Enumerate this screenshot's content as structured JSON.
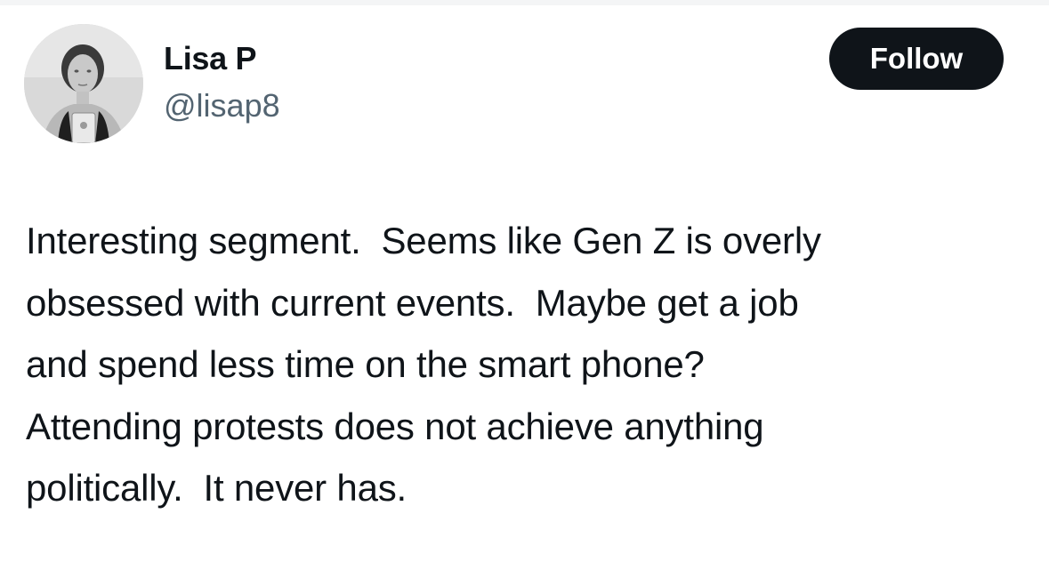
{
  "tweet": {
    "author": {
      "display_name": "Lisa P",
      "handle": "@lisap8",
      "avatar_icon": "profile-photo"
    },
    "follow_label": "Follow",
    "text": "Interesting segment.  Seems like Gen Z is overly\nobsessed with current events.  Maybe get a job\nand spend less time on the smart phone?\nAttending protests does not achieve anything\npolitically.  It never has."
  },
  "colors": {
    "text_primary": "#0f1419",
    "text_secondary": "#536471",
    "button_bg": "#0f1419",
    "button_text": "#ffffff"
  }
}
